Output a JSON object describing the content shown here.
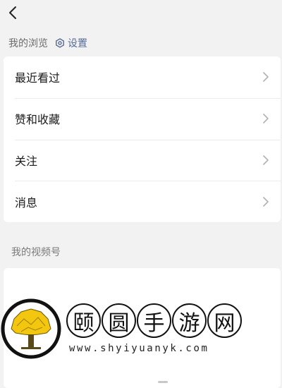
{
  "topbar": {
    "back_icon": "chevron-left-icon"
  },
  "browse_section": {
    "title": "我的浏览",
    "settings_label": "设置",
    "settings_icon": "gear-icon"
  },
  "browse_items": [
    {
      "label": "最近看过"
    },
    {
      "label": "赞和收藏"
    },
    {
      "label": "关注"
    },
    {
      "label": "消息"
    }
  ],
  "channels_section": {
    "title": "我的视频号"
  },
  "watermark": {
    "chars": [
      "颐",
      "圆",
      "手",
      "游",
      "网"
    ],
    "url": "www.shyiyuanyk.com"
  },
  "colors": {
    "link": "#576b95",
    "background": "#f2f2f2",
    "card": "#ffffff"
  }
}
